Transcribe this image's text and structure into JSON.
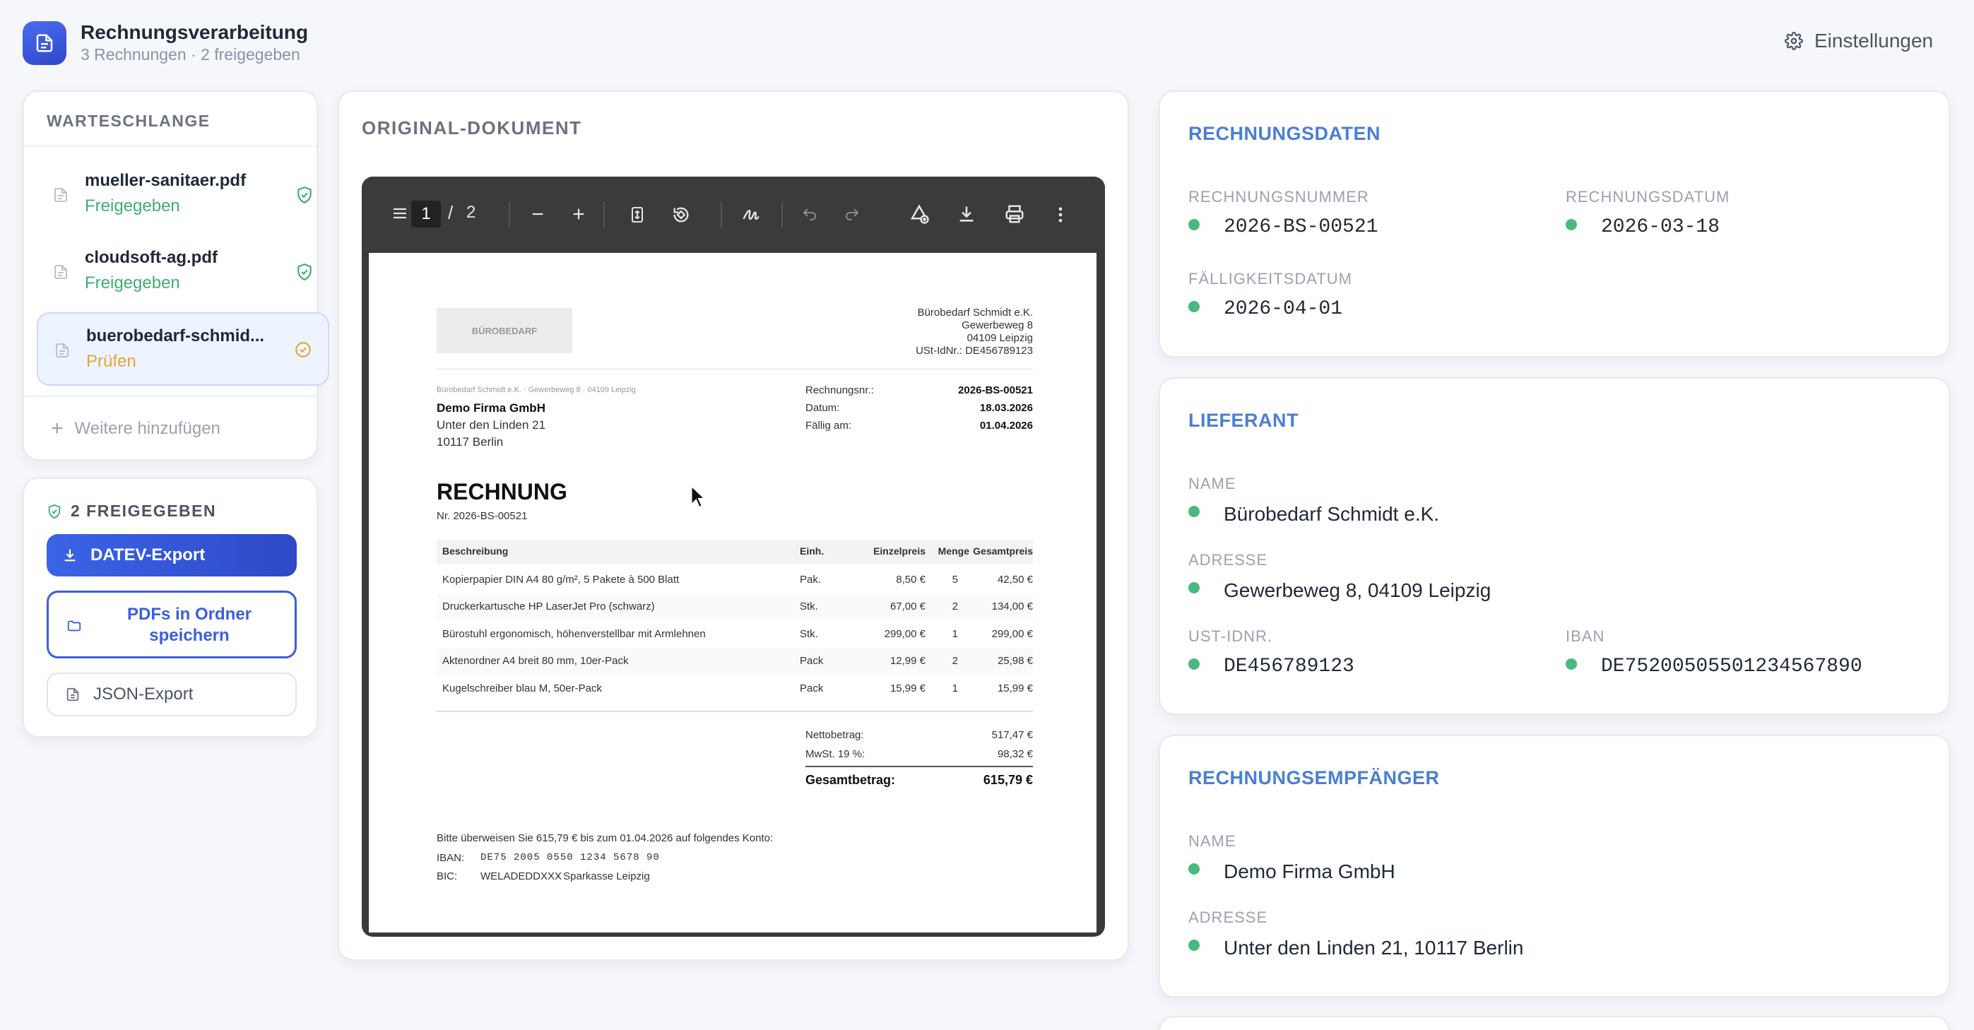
{
  "app": {
    "title": "Rechnungsverarbeitung",
    "subtitle": "3 Rechnungen · 2 freigegeben",
    "settings_label": "Einstellungen"
  },
  "queue": {
    "heading": "WARTESCHLANGE",
    "items": [
      {
        "filename": "mueller-sanitaer.pdf",
        "status": "Freigegeben",
        "status_color": "#3fae74"
      },
      {
        "filename": "cloudsoft-ag.pdf",
        "status": "Freigegeben",
        "status_color": "#3fae74"
      },
      {
        "filename": "buerobedarf-schmid...",
        "status": "Prüfen",
        "status_color": "#e4a636"
      }
    ],
    "add_more": "Weitere hinzufügen"
  },
  "export": {
    "heading": "2 FREIGEGEBEN",
    "datev": "DATEV-Export",
    "pdfs": "PDFs in Ordner speichern",
    "json": "JSON-Export"
  },
  "document": {
    "heading": "ORIGINAL-DOKUMENT",
    "viewer": {
      "page": "1",
      "sep": "/",
      "total": "2"
    },
    "invoice": {
      "logo": "BÜROBEDARF",
      "sender": [
        "Bürobedarf Schmidt e.K.",
        "Gewerbeweg 8",
        "04109 Leipzig",
        "USt-IdNr.: DE456789123"
      ],
      "sender_line": "Bürobedarf Schmidt e.K. · Gewerbeweg 8 · 04109 Leipzig",
      "recipient": {
        "name": "Demo Firma GmbH",
        "street": "Unter den Linden 21",
        "city": "10117 Berlin"
      },
      "meta": [
        {
          "label": "Rechnungsnr.:",
          "value": "2026-BS-00521"
        },
        {
          "label": "Datum:",
          "value": "18.03.2026"
        },
        {
          "label": "Fällig am:",
          "value": "01.04.2026"
        }
      ],
      "title": "RECHNUNG",
      "number_line": "Nr. 2026-BS-00521",
      "columns": [
        "Beschreibung",
        "Menge",
        "Einh.",
        "Einzelpreis",
        "Gesamtpreis"
      ],
      "rows": [
        [
          "Kopierpapier DIN A4 80 g/m², 5 Pakete à 500 Blatt",
          "5",
          "Pak.",
          "8,50 €",
          "42,50 €"
        ],
        [
          "Druckerkartusche HP LaserJet Pro (schwarz)",
          "2",
          "Stk.",
          "67,00 €",
          "134,00 €"
        ],
        [
          "Bürostuhl ergonomisch, höhenverstellbar mit Armlehnen",
          "1",
          "Stk.",
          "299,00 €",
          "299,00 €"
        ],
        [
          "Aktenordner A4 breit 80 mm, 10er-Pack",
          "2",
          "Pack",
          "12,99 €",
          "25,98 €"
        ],
        [
          "Kugelschreiber blau M, 50er-Pack",
          "1",
          "Pack",
          "15,99 €",
          "15,99 €"
        ]
      ],
      "net_label": "Nettobetrag:",
      "net": "517,47 €",
      "vat_label": "MwSt. 19 %:",
      "vat": "98,32 €",
      "total_label": "Gesamtbetrag:",
      "total": "615,79 €",
      "pay_note": "Bitte überweisen Sie 615,79 € bis zum 01.04.2026 auf folgendes Konto:",
      "iban_label": "IBAN:",
      "iban": "DE75 2005 0550 1234 5678 90",
      "bic_label": "BIC:",
      "bic": "WELADEDDXXX",
      "bank": "· Sparkasse Leipzig"
    }
  },
  "rechnungsdaten": {
    "title": "RECHNUNGSDATEN",
    "nr_label": "RECHNUNGSNUMMER",
    "nr": "2026-BS-00521",
    "date_label": "RECHNUNGSDATUM",
    "date": "2026-03-18",
    "due_label": "FÄLLIGKEITSDATUM",
    "due": "2026-04-01"
  },
  "lieferant": {
    "title": "LIEFERANT",
    "name_label": "NAME",
    "name": "Bürobedarf Schmidt e.K.",
    "addr_label": "ADRESSE",
    "addr": "Gewerbeweg 8, 04109 Leipzig",
    "ust_label": "UST-IDNR.",
    "ust": "DE456789123",
    "iban_label": "IBAN",
    "iban": "DE75200505501234567890"
  },
  "empfaenger": {
    "title": "RECHNUNGSEMPFÄNGER",
    "name_label": "NAME",
    "name": "Demo Firma GmbH",
    "addr_label": "ADRESSE",
    "addr": "Unter den Linden 21, 10117 Berlin"
  },
  "colors": {
    "accent": "#3a5ee0",
    "ok": "#49b97f",
    "warn": "#e4a636",
    "section": "#4a7fd1"
  }
}
